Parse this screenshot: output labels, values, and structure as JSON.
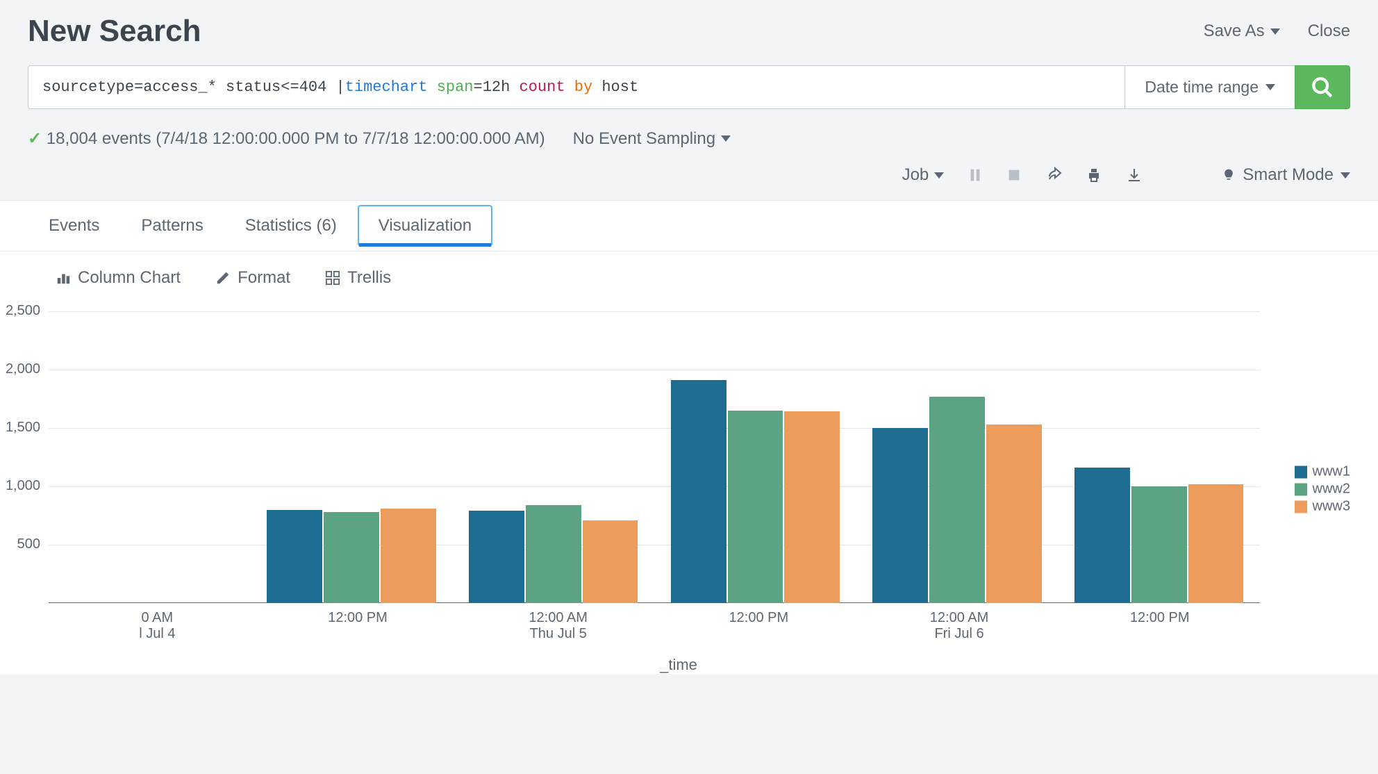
{
  "header": {
    "title": "New Search",
    "save_as": "Save As",
    "close": "Close"
  },
  "search": {
    "query_parts": {
      "p1": "sourcetype=access_* status<=404 |",
      "cmd": "timechart",
      "arg": "span",
      "eq": "=12h ",
      "count": "count",
      "by": "by",
      "host": "host"
    },
    "time_range": "Date time range"
  },
  "status": {
    "events": "18,004 events (7/4/18 12:00:00.000 PM to 7/7/18 12:00:00.000 AM)",
    "sampling": "No Event Sampling"
  },
  "controls": {
    "job": "Job",
    "smart_mode": "Smart Mode"
  },
  "tabs": {
    "events": "Events",
    "patterns": "Patterns",
    "statistics": "Statistics (6)",
    "visualization": "Visualization"
  },
  "viz_toolbar": {
    "chart_type": "Column Chart",
    "format": "Format",
    "trellis": "Trellis"
  },
  "chart_data": {
    "type": "bar",
    "xlabel": "_time",
    "ylabel": "",
    "ylim": [
      0,
      2500
    ],
    "y_ticks": [
      "2,500",
      "2,000",
      "1,500",
      "1,000",
      "500"
    ],
    "categories": [
      {
        "top": "0 AM",
        "sub": "l Jul 4"
      },
      {
        "top": "12:00 PM",
        "sub": ""
      },
      {
        "top": "12:00 AM",
        "sub": "Thu Jul 5"
      },
      {
        "top": "12:00 PM",
        "sub": ""
      },
      {
        "top": "12:00 AM",
        "sub": "Fri Jul 6"
      },
      {
        "top": "12:00 PM",
        "sub": ""
      }
    ],
    "series": [
      {
        "name": "www1",
        "color": "#1e6d91",
        "values": [
          0,
          800,
          790,
          1910,
          1500,
          1160
        ]
      },
      {
        "name": "www2",
        "color": "#5ba383",
        "values": [
          0,
          780,
          840,
          1650,
          1770,
          1000
        ]
      },
      {
        "name": "www3",
        "color": "#ec9c5b",
        "values": [
          0,
          810,
          710,
          1640,
          1530,
          1020
        ]
      }
    ]
  }
}
